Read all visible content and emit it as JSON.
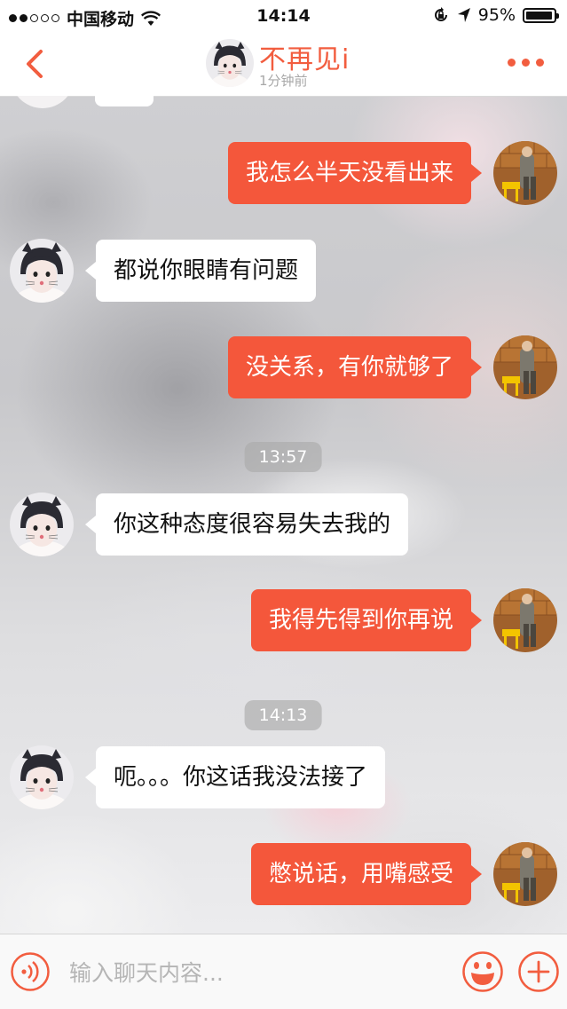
{
  "status_bar": {
    "carrier": "中国移动",
    "time": "14:14",
    "battery": "95%",
    "battery_level": 0.95
  },
  "nav": {
    "title": "不再见i",
    "subtitle": "1分钟前"
  },
  "chat": {
    "messages": [
      {
        "side": "out",
        "text": "我怎么半天没看出来"
      },
      {
        "side": "in",
        "text": "都说你眼睛有问题"
      },
      {
        "side": "out",
        "text": "没关系，有你就够了"
      },
      {
        "type": "time",
        "text": "13:57"
      },
      {
        "side": "in",
        "text": "你这种态度很容易失去我的"
      },
      {
        "side": "out",
        "text": "我得先得到你再说"
      },
      {
        "type": "time",
        "text": "14:13"
      },
      {
        "side": "in",
        "text": "呃。。。你这话我没法接了"
      },
      {
        "side": "out",
        "text": "憋说话，用嘴感受"
      }
    ]
  },
  "input": {
    "placeholder": "输入聊天内容..."
  },
  "colors": {
    "accent": "#f4573b",
    "title": "#f25d3f"
  }
}
